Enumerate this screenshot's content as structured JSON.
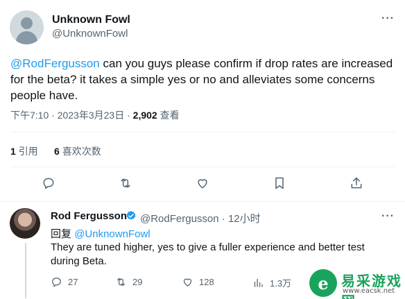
{
  "tweet": {
    "author_name": "Unknown Fowl",
    "author_handle": "@UnknownFowl",
    "text_mention": "@RodFergusson",
    "text_body": " can you guys please confirm if drop rates are increased for the beta? it takes a simple yes or no and alleviates some concerns people have.",
    "time": "下午7:10",
    "date": "2023年3月23日",
    "views_count": "2,902",
    "views_label": "查看",
    "quotes_count": "1",
    "quotes_label": "引用",
    "likes_count": "6",
    "likes_label": "喜欢次数",
    "more_icon": "more-horizontal-icon"
  },
  "actions": [
    {
      "icon": "reply-icon"
    },
    {
      "icon": "retweet-icon"
    },
    {
      "icon": "like-icon"
    },
    {
      "icon": "bookmark-icon"
    },
    {
      "icon": "share-icon"
    }
  ],
  "reply": {
    "author_name": "Rod Fergusson",
    "author_handle": "@RodFergusson",
    "time_ago": "12小时",
    "replying_prefix": "回复",
    "replying_to": "@UnknownFowl",
    "text": "They are tuned higher, yes to give a fuller experience and better test during Beta.",
    "replies": "27",
    "retweets": "29",
    "likes": "128",
    "views": "1.3万",
    "verified_color": "#1d9bf0"
  },
  "watermark": {
    "logo_letter": "e",
    "name": "易采游戏网",
    "url": "www.eacsk.net"
  },
  "colors": {
    "text": "#0f1419",
    "secondary": "#536471",
    "accent": "#1d9bf0",
    "watermark_green": "#1aa35c"
  }
}
